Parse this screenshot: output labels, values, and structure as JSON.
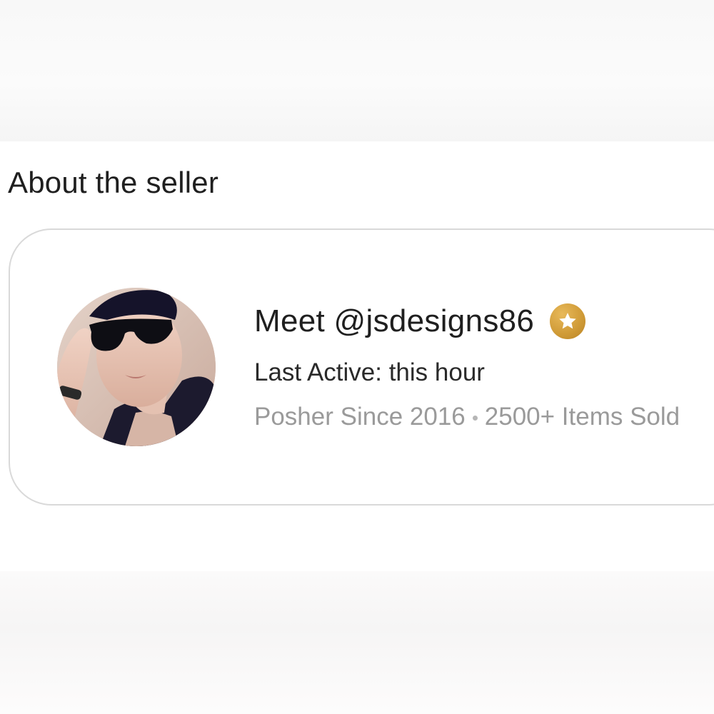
{
  "section": {
    "title": "About the seller"
  },
  "seller": {
    "meet_label": "Meet @jsdesigns86",
    "badge_icon": "star-badge-icon",
    "badge_color": "#cf9a36",
    "last_active": "Last Active: this hour",
    "posher_since": "Posher Since 2016",
    "items_sold": "2500+ Items Sold"
  }
}
